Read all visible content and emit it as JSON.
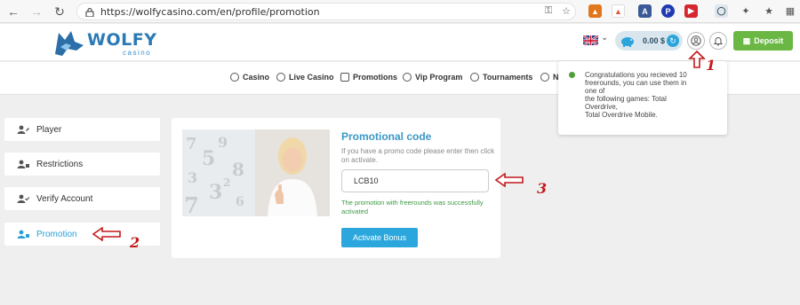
{
  "browser": {
    "url": "https://wolfycasino.com/en/profile/promotion"
  },
  "header": {
    "logo_word": "WOLFY",
    "logo_sub": "casino",
    "balance": "0.00 $",
    "deposit_label": "Deposit"
  },
  "menu": {
    "items": [
      {
        "label": "Casino"
      },
      {
        "label": "Live Casino"
      },
      {
        "label": "Promotions"
      },
      {
        "label": "Vip Program"
      },
      {
        "label": "Tournaments"
      },
      {
        "label": "N"
      }
    ]
  },
  "notification": {
    "lines": [
      "Congratulations you recieved 10",
      "freerounds, you can use them in",
      "one of",
      "the following games: Total",
      "Overdrive,",
      "Total Overdrive Mobile."
    ]
  },
  "sidebar": {
    "items": [
      {
        "label": "Player"
      },
      {
        "label": "Restrictions"
      },
      {
        "label": "Verify Account"
      },
      {
        "label": "Promotion"
      }
    ]
  },
  "promo": {
    "title": "Promotional code",
    "description": "If you have a promo code please enter then click on activate.",
    "code_value": "LCB10",
    "success": "The promotion with freerounds was successfully activated",
    "activate_label": "Activate Bonus"
  },
  "annotations": {
    "n1": "1",
    "n2": "2",
    "n3": "3"
  },
  "colors": {
    "accent": "#2aa5dc",
    "deposit": "#6bb743",
    "success": "#3d9a44",
    "annotation": "#c4191c"
  }
}
